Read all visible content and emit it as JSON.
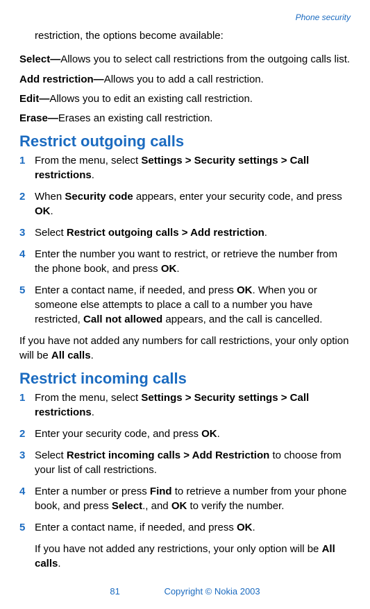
{
  "header": {
    "section": "Phone security"
  },
  "intro": "restriction, the options become available:",
  "defs": {
    "select": {
      "term": "Select—",
      "text": "Allows you to select call restrictions from the outgoing calls list."
    },
    "add": {
      "term": "Add restriction—",
      "text": "Allows you to add a call restriction."
    },
    "edit": {
      "term": "Edit—",
      "text": "Allows you to edit an existing call restriction."
    },
    "erase": {
      "term": "Erase—",
      "text": "Erases an existing call restriction."
    }
  },
  "outgoing": {
    "heading": "Restrict outgoing calls",
    "s1a": "From the menu, select ",
    "s1b": "Settings > Security settings > Call restrictions",
    "s1c": ".",
    "s2a": "When ",
    "s2b": "Security code",
    "s2c": " appears, enter your security code, and press ",
    "s2d": "OK",
    "s2e": ".",
    "s3a": "Select ",
    "s3b": "Restrict outgoing calls > Add restriction",
    "s3c": ".",
    "s4a": "Enter the number you want to restrict, or retrieve the number from the phone book, and press ",
    "s4b": "OK",
    "s4c": ".",
    "s5a": "Enter a contact name, if needed, and press ",
    "s5b": "OK",
    "s5c": ". When you or someone else attempts to place a call to a number you have restricted, ",
    "s5d": "Call not allowed",
    "s5e": " appears, and the call is cancelled.",
    "note_a": "If you have not added any numbers for call restrictions, your only option will be ",
    "note_b": "All calls",
    "note_c": "."
  },
  "incoming": {
    "heading": "Restrict incoming calls",
    "s1a": "From the menu, select ",
    "s1b": "Settings > Security settings > Call restrictions",
    "s1c": ".",
    "s2a": "Enter your security code, and press ",
    "s2b": "OK",
    "s2c": ".",
    "s3a": "Select ",
    "s3b": "Restrict incoming calls > Add Restriction",
    "s3c": " to choose from your list of call restrictions.",
    "s4a": "Enter a number or press ",
    "s4b": "Find",
    "s4c": " to retrieve a number from your phone book, and press ",
    "s4d": "Select",
    "s4e": "., and ",
    "s4f": "OK",
    "s4g": " to verify the number.",
    "s5a": "Enter a contact name, if needed, and press ",
    "s5b": "OK",
    "s5c": ".",
    "note_a": "If you have not added any restrictions, your only option will be ",
    "note_b": "All calls",
    "note_c": "."
  },
  "footer": {
    "page": "81",
    "copyright": "Copyright © Nokia 2003"
  }
}
